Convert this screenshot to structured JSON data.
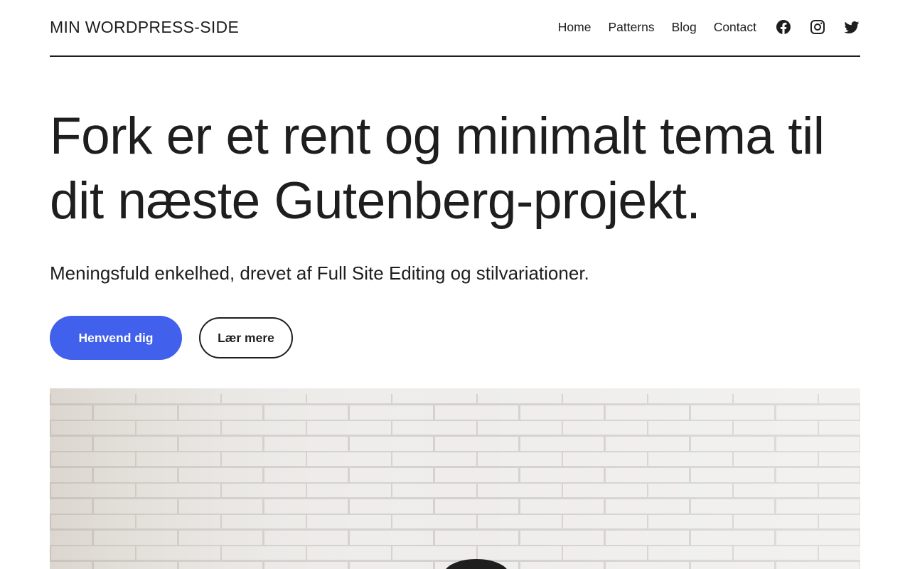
{
  "header": {
    "site_title": "MIN WORDPRESS-SIDE",
    "nav": [
      {
        "label": "Home"
      },
      {
        "label": "Patterns"
      },
      {
        "label": "Blog"
      },
      {
        "label": "Contact"
      }
    ],
    "social": [
      "facebook-icon",
      "instagram-icon",
      "twitter-icon"
    ]
  },
  "hero": {
    "title": "Fork er et rent og minimalt tema til dit næste Gutenberg-projekt.",
    "subtitle": "Meningsfuld enkelhed, drevet af Full Site Editing og stilvariationer.",
    "primary_button": "Henvend dig",
    "secondary_button": "Lær mere"
  },
  "colors": {
    "accent": "#4160eb",
    "text": "#1e1e1e",
    "background": "#ffffff"
  }
}
